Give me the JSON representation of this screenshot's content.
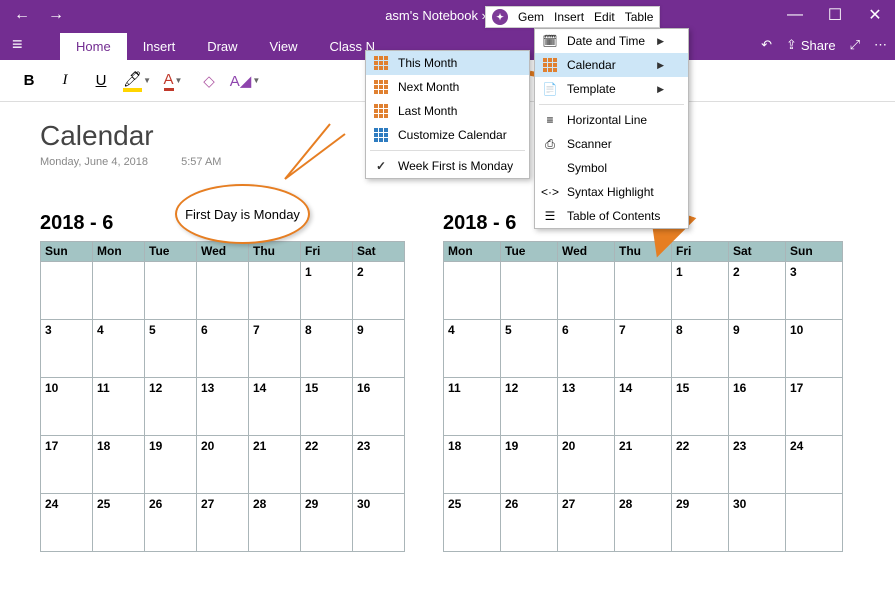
{
  "titlebar": {
    "title": "asm's Notebook » Qu"
  },
  "tabs": {
    "home": "Home",
    "insert": "Insert",
    "draw": "Draw",
    "view": "View",
    "classnb": "Class N"
  },
  "ribbonRight": {
    "share": "Share"
  },
  "page": {
    "title": "Calendar",
    "date": "Monday, June 4, 2018",
    "time": "5:57 AM"
  },
  "callout": {
    "text": "First Day is Monday"
  },
  "gemmenu": {
    "gem": "Gem",
    "insert": "Insert",
    "edit": "Edit",
    "table": "Table"
  },
  "submenu1": {
    "thisMonth": "This Month",
    "nextMonth": "Next Month",
    "lastMonth": "Last Month",
    "customize": "Customize Calendar",
    "weekFirst": "Week First is Monday"
  },
  "submenu2": {
    "datetime": "Date and Time",
    "calendar": "Calendar",
    "template": "Template",
    "hline": "Horizontal Line",
    "scanner": "Scanner",
    "symbol": "Symbol",
    "syntax": "Syntax Highlight",
    "toc": "Table of Contents"
  },
  "calLeft": {
    "title": "2018 - 6",
    "headers": [
      "Sun",
      "Mon",
      "Tue",
      "Wed",
      "Thu",
      "Fri",
      "Sat"
    ],
    "rows": [
      [
        "",
        "",
        "",
        "",
        "",
        "1",
        "2"
      ],
      [
        "3",
        "4",
        "5",
        "6",
        "7",
        "8",
        "9"
      ],
      [
        "10",
        "11",
        "12",
        "13",
        "14",
        "15",
        "16"
      ],
      [
        "17",
        "18",
        "19",
        "20",
        "21",
        "22",
        "23"
      ],
      [
        "24",
        "25",
        "26",
        "27",
        "28",
        "29",
        "30"
      ]
    ]
  },
  "calRight": {
    "title": "2018 - 6",
    "headers": [
      "Mon",
      "Tue",
      "Wed",
      "Thu",
      "Fri",
      "Sat",
      "Sun"
    ],
    "rows": [
      [
        "",
        "",
        "",
        "",
        "1",
        "2",
        "3"
      ],
      [
        "4",
        "5",
        "6",
        "7",
        "8",
        "9",
        "10"
      ],
      [
        "11",
        "12",
        "13",
        "14",
        "15",
        "16",
        "17"
      ],
      [
        "18",
        "19",
        "20",
        "21",
        "22",
        "23",
        "24"
      ],
      [
        "25",
        "26",
        "27",
        "28",
        "29",
        "30",
        ""
      ]
    ]
  }
}
